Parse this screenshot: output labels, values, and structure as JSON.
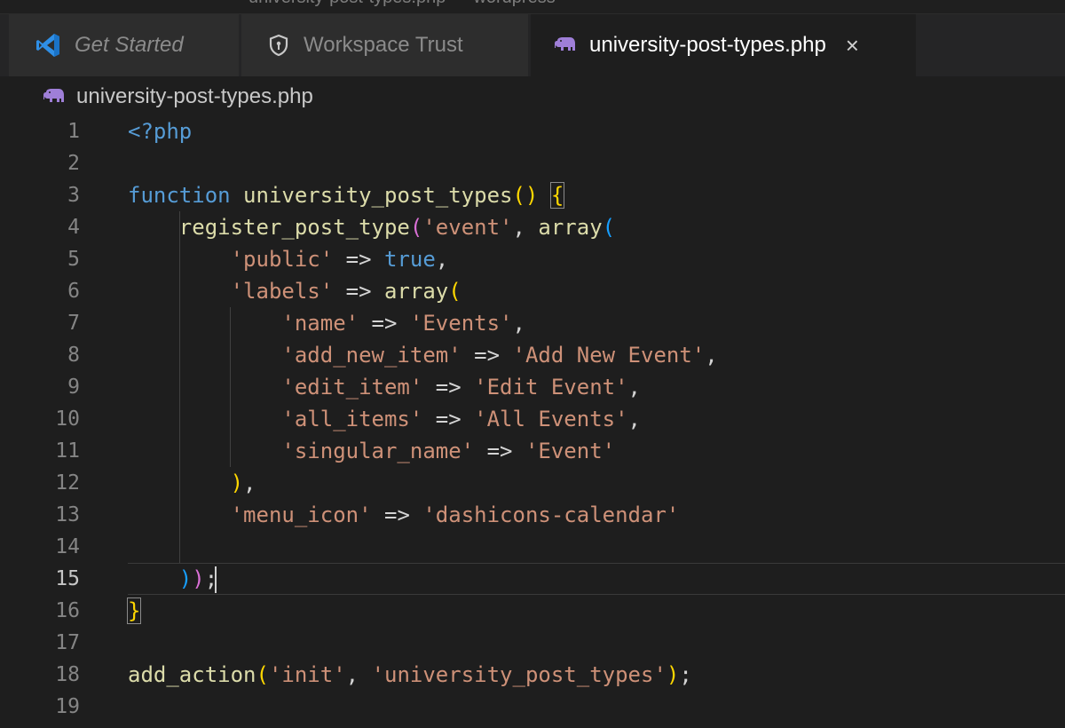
{
  "titlebar": {
    "text": "university-post-types.php — wordpress"
  },
  "tabs": [
    {
      "label": "Get Started",
      "icon": "vscode-logo-icon"
    },
    {
      "label": "Workspace Trust",
      "icon": "shield-icon"
    },
    {
      "label": "university-post-types.php",
      "icon": "php-elephant-icon",
      "close": "×"
    }
  ],
  "breadcrumb": {
    "file": "university-post-types.php"
  },
  "editor": {
    "active_line": 15,
    "lines": [
      {
        "n": "1"
      },
      {
        "n": "2"
      },
      {
        "n": "3"
      },
      {
        "n": "4"
      },
      {
        "n": "5"
      },
      {
        "n": "6"
      },
      {
        "n": "7"
      },
      {
        "n": "8"
      },
      {
        "n": "9"
      },
      {
        "n": "10"
      },
      {
        "n": "11"
      },
      {
        "n": "12"
      },
      {
        "n": "13"
      },
      {
        "n": "14"
      },
      {
        "n": "15"
      },
      {
        "n": "16"
      },
      {
        "n": "17"
      },
      {
        "n": "18"
      },
      {
        "n": "19"
      }
    ],
    "code": {
      "php_open": "<?php",
      "kw_function": "function",
      "fn_name": "university_post_types",
      "register": "register_post_type",
      "s_event": "'event'",
      "array": "array",
      "s_public": "'public'",
      "arrow": "=>",
      "v_true": "true",
      "s_labels": "'labels'",
      "s_name": "'name'",
      "s_events": "'Events'",
      "s_add_new_item": "'add_new_item'",
      "s_add_new_event": "'Add New Event'",
      "s_edit_item": "'edit_item'",
      "s_edit_event": "'Edit Event'",
      "s_all_items": "'all_items'",
      "s_all_events": "'All Events'",
      "s_singular_name": "'singular_name'",
      "s_event_single": "'Event'",
      "s_menu_icon": "'menu_icon'",
      "s_dashicons": "'dashicons-calendar'",
      "add_action": "add_action",
      "s_init": "'init'",
      "s_hook": "'university_post_types'"
    }
  },
  "colors": {
    "keyword": "#569cd6",
    "function": "#dcdcaa",
    "string": "#ce9178",
    "bracket_1": "#ffd700",
    "bracket_2": "#da70d6",
    "bracket_3": "#179fff"
  }
}
